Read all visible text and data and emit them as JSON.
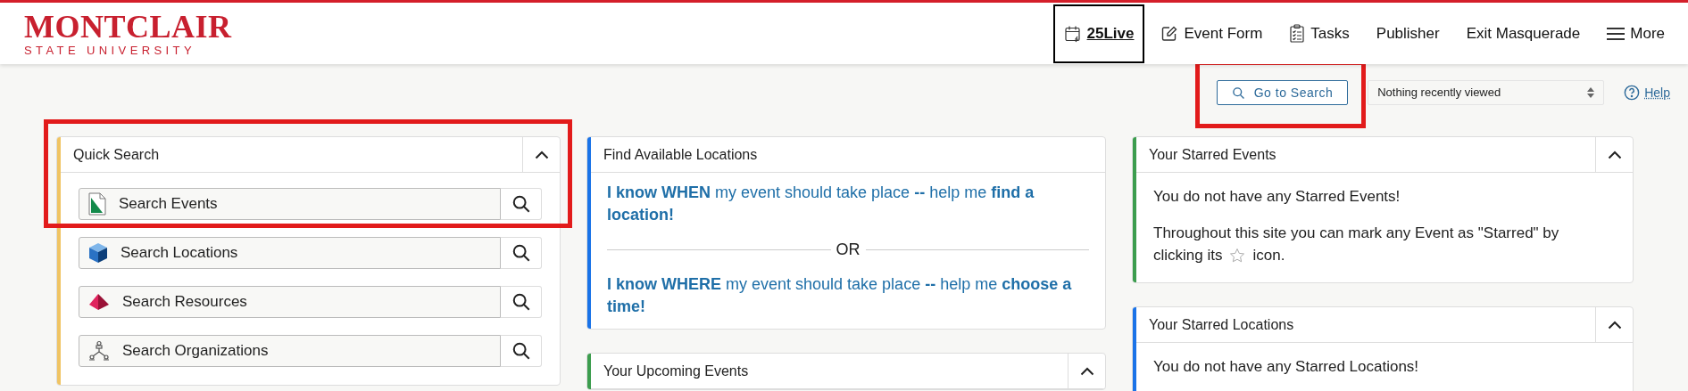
{
  "header": {
    "logo": {
      "name": "MONTCLAIR",
      "subtitle": "STATE UNIVERSITY"
    },
    "nav": [
      {
        "label": "25Live",
        "kind": "calendar",
        "selected": true
      },
      {
        "label": "Event Form",
        "kind": "edit",
        "selected": false
      },
      {
        "label": "Tasks",
        "kind": "clipboard",
        "selected": false
      },
      {
        "label": "Publisher",
        "kind": "text",
        "selected": false
      },
      {
        "label": "Exit Masquerade",
        "kind": "text",
        "selected": false
      },
      {
        "label": "More",
        "kind": "menu",
        "selected": false
      }
    ]
  },
  "toolbar": {
    "search_button": {
      "label": "Go to Search",
      "highlighted": true
    },
    "recent": {
      "value": "Nothing recently viewed"
    },
    "help": "Help"
  },
  "columns": [
    [
      {
        "title": "Quick Search",
        "color": "#f0c463",
        "collapsible": true,
        "highlighted": true,
        "kind": "quick_search",
        "items": [
          {
            "label": "Search Events",
            "kind": "event"
          },
          {
            "label": "Search Locations",
            "kind": "location"
          },
          {
            "label": "Search Resources",
            "kind": "resource"
          },
          {
            "label": "Search Organizations",
            "kind": "organization"
          }
        ]
      }
    ],
    [
      {
        "title": "Find Available Locations",
        "color": "#1a73e8",
        "collapsible": false,
        "highlighted": false,
        "kind": "finder",
        "first": "**I know WHEN** my event should take place **--** help me **find a location!**",
        "divider": "OR",
        "second": "**I know WHERE** my event should take place **--** help me **choose a time!**"
      },
      {
        "title": "Your Upcoming Events",
        "color": "#3c9d4e",
        "collapsible": true,
        "highlighted": false,
        "kind": "empty"
      }
    ],
    [
      {
        "title": "Your Starred Events",
        "color": "#3c9d4e",
        "collapsible": true,
        "highlighted": false,
        "kind": "starred",
        "message": "You do not have any Starred Events!",
        "hint_line": "Throughout this site you can mark any Event as \"Starred\" by",
        "hint_before": "clicking its",
        "hint_after": "icon."
      },
      {
        "title": "Your Starred Locations",
        "color": "#1a73e8",
        "collapsible": true,
        "highlighted": false,
        "kind": "starred",
        "message": "You do not have any Starred Locations!"
      }
    ]
  ]
}
